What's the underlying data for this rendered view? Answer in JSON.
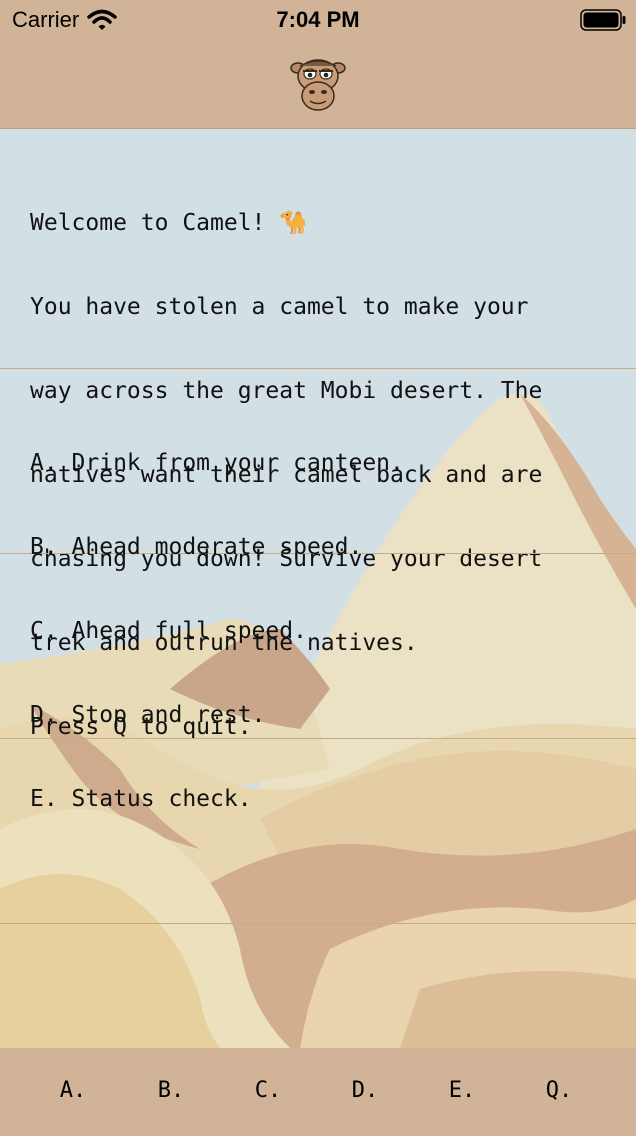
{
  "status_bar": {
    "carrier": "Carrier",
    "time": "7:04 PM",
    "icons": [
      "wifi-icon",
      "battery-icon"
    ]
  },
  "nav_bar": {
    "logo_icon": "camel-face-icon"
  },
  "welcome": {
    "lines": [
      "Welcome to Camel! 🐪",
      "You have stolen a camel to make your",
      "way across the great Mobi desert. The",
      "natives want their camel back and are",
      "chasing you down! Survive your desert",
      "trek and outrun the natives.",
      "Press Q to quit."
    ]
  },
  "options": {
    "lines": [
      "A. Drink from your canteen.",
      "B. Ahead moderate speed.",
      "C. Ahead full speed.",
      "D. Stop and rest.",
      "E. Status check."
    ]
  },
  "toolbar": {
    "buttons": [
      "A.",
      "B.",
      "C.",
      "D.",
      "E.",
      "Q."
    ]
  },
  "colors": {
    "bar_background": "#d1b498",
    "sky": "#d2e0e6",
    "sand_light": "#eee3c4",
    "sand_mid": "#e6d3ab",
    "sand_dark": "#cfaa8c"
  }
}
